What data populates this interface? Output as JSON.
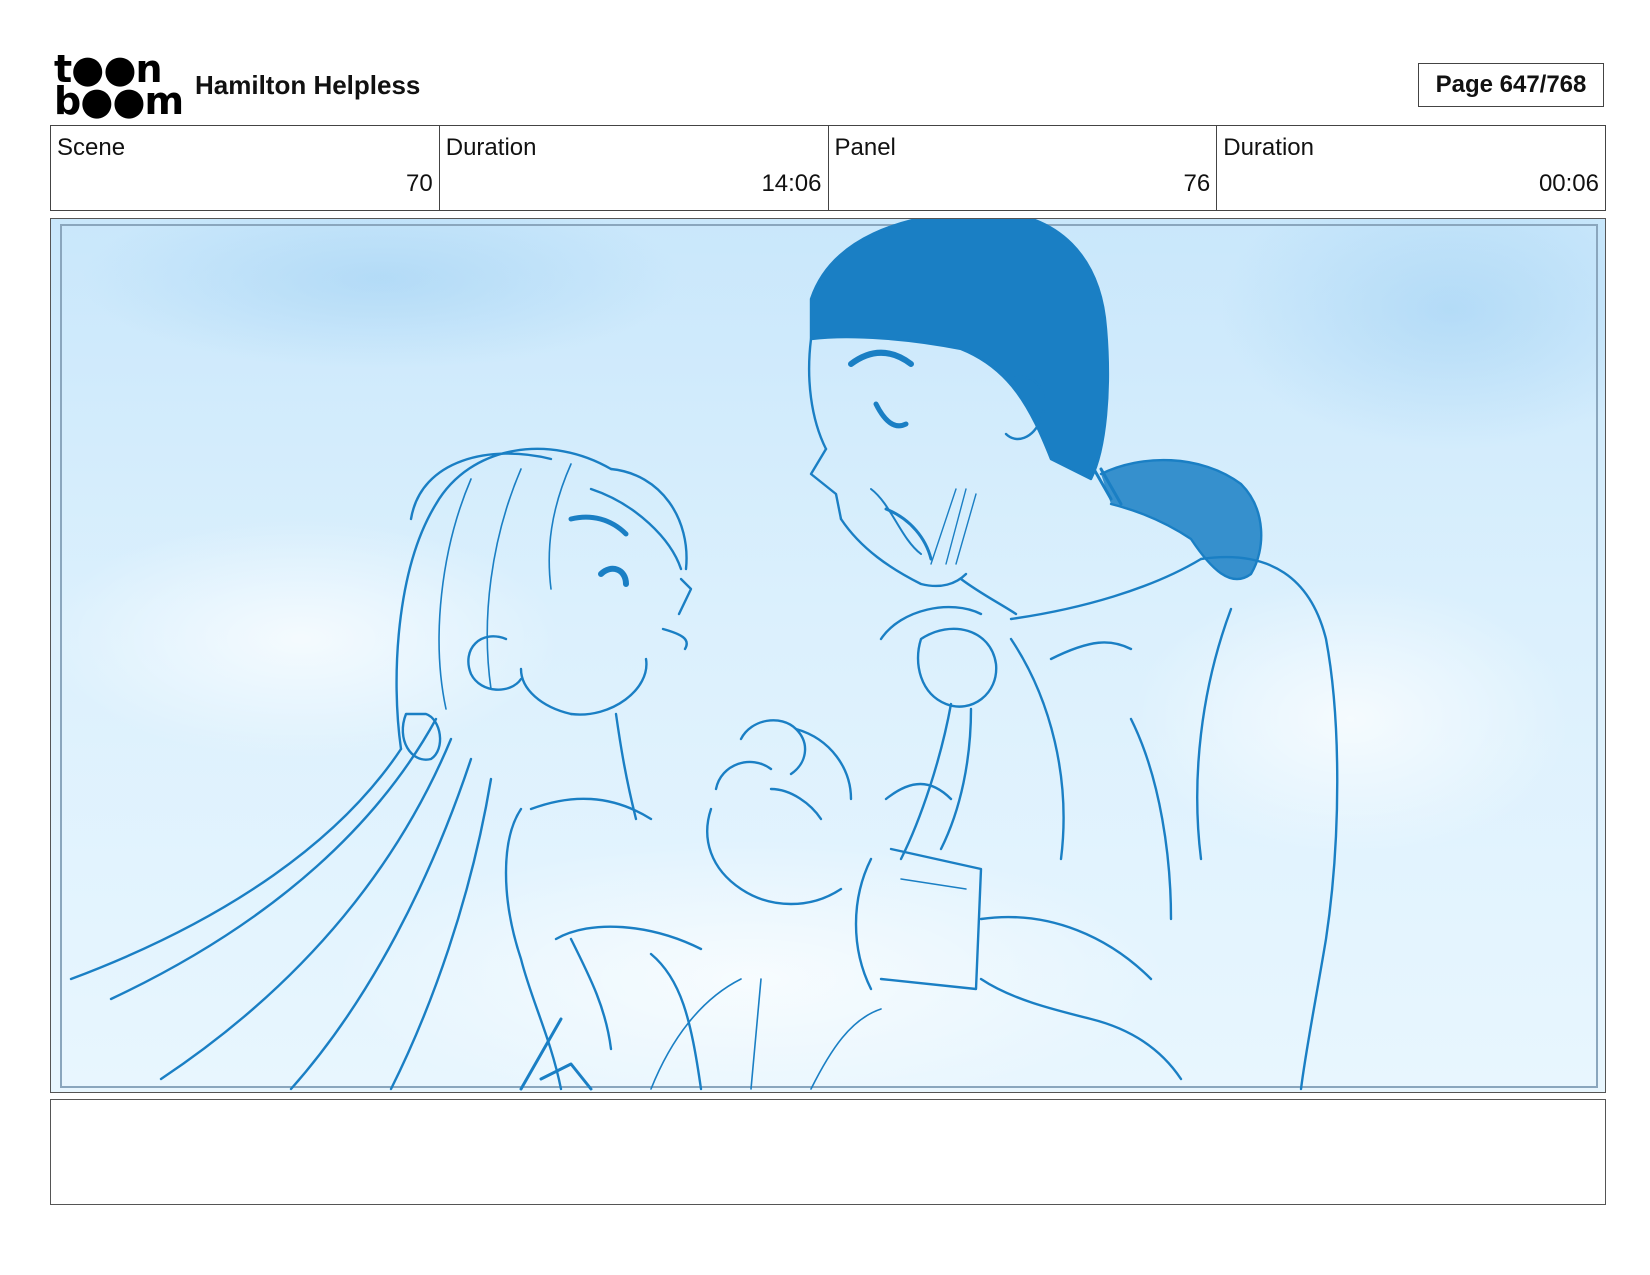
{
  "header": {
    "logo_text": "toon boom",
    "document_title": "Hamilton Helpless",
    "page_indicator": "Page 647/768"
  },
  "info": {
    "cells": [
      {
        "label": "Scene",
        "value": "70"
      },
      {
        "label": "Duration",
        "value": "14:06"
      },
      {
        "label": "Panel",
        "value": "76"
      },
      {
        "label": "Duration",
        "value": "00:06"
      }
    ]
  },
  "panel": {
    "image_icon": "storyboard-sketch",
    "line_color": "#1a7fc4",
    "sky_color": "#cfe9fb"
  },
  "caption": {
    "text": ""
  }
}
